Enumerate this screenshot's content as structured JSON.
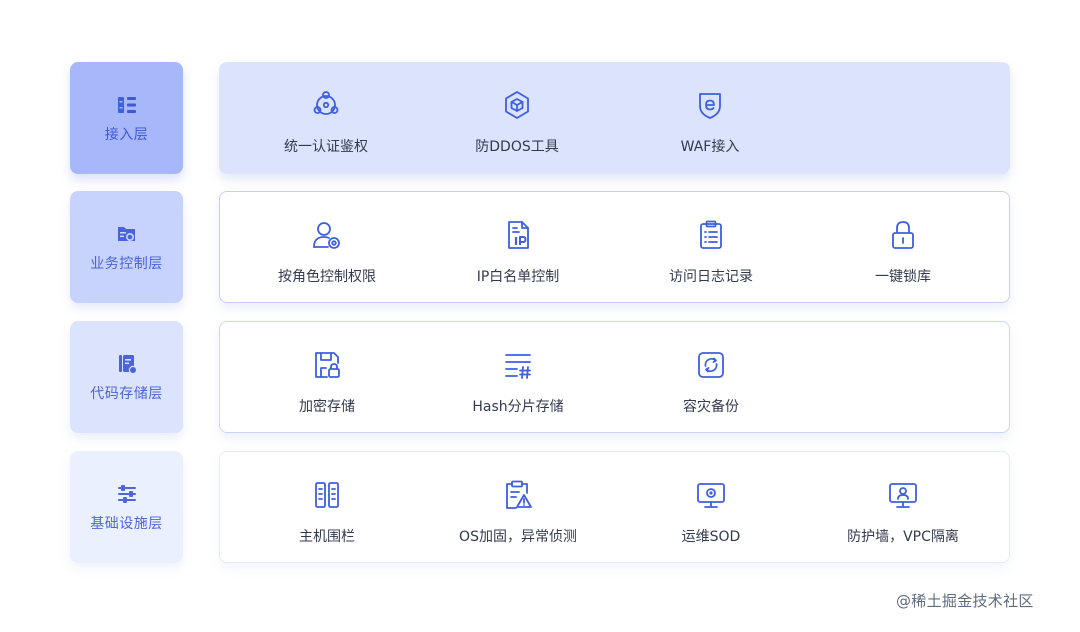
{
  "layers": [
    {
      "label": "接入层",
      "icon": "list-blocks-icon",
      "items": [
        {
          "label": "统一认证鉴权",
          "icon": "network-nodes-icon"
        },
        {
          "label": "防DDOS工具",
          "icon": "hexagon-cube-icon"
        },
        {
          "label": "WAF接入",
          "icon": "shield-e-icon"
        }
      ]
    },
    {
      "label": "业务控制层",
      "icon": "folder-gear-icon",
      "items": [
        {
          "label": "按角色控制权限",
          "icon": "user-gear-icon"
        },
        {
          "label": "IP白名单控制",
          "icon": "document-ip-icon"
        },
        {
          "label": "访问日志记录",
          "icon": "clipboard-list-icon"
        },
        {
          "label": "一键锁库",
          "icon": "lock-icon"
        }
      ]
    },
    {
      "label": "代码存储层",
      "icon": "book-storage-icon",
      "items": [
        {
          "label": "加密存储",
          "icon": "floppy-lock-icon"
        },
        {
          "label": "Hash分片存储",
          "icon": "lines-hash-icon"
        },
        {
          "label": "容灾备份",
          "icon": "refresh-box-icon"
        }
      ]
    },
    {
      "label": "基础设施层",
      "icon": "sliders-icon",
      "items": [
        {
          "label": "主机围栏",
          "icon": "server-racks-icon"
        },
        {
          "label": "OS加固，异常侦测",
          "icon": "document-warning-icon"
        },
        {
          "label": "运维SOD",
          "icon": "monitor-gear-icon"
        },
        {
          "label": "防护墙，VPC隔离",
          "icon": "monitor-person-icon"
        }
      ]
    }
  ],
  "watermark": "@稀土掘金技术社区",
  "colors": {
    "accent": "#3e5fe0",
    "label_bg": [
      "#a7b8fa",
      "#c7d3fc",
      "#dbe3fd",
      "#ebf0fe"
    ],
    "panel_top_bg": "#dbe3fd",
    "text": "#333a4d"
  }
}
